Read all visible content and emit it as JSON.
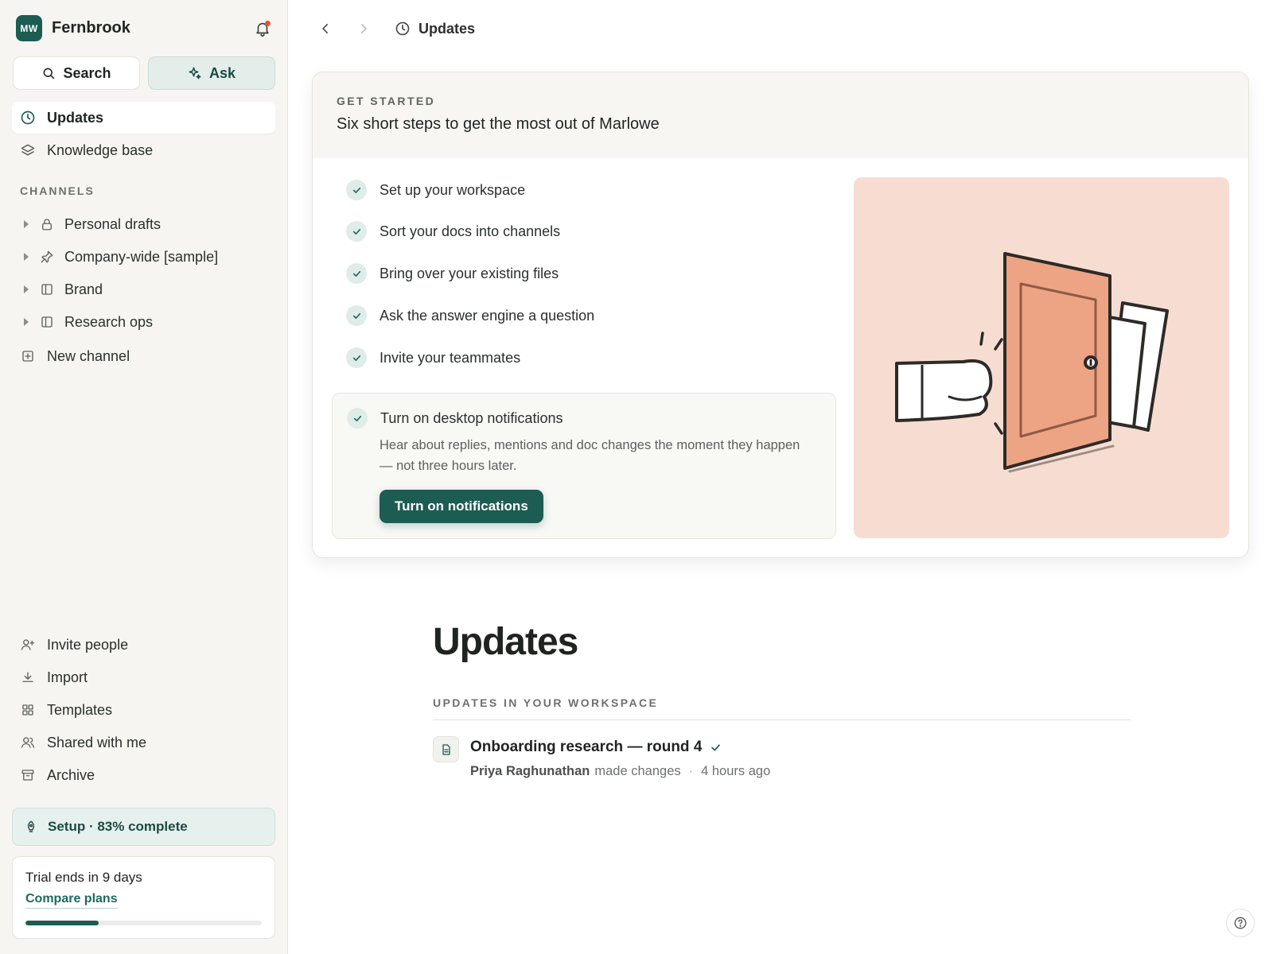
{
  "workspace": {
    "initials": "MW",
    "name": "Fernbrook"
  },
  "sidebar": {
    "search_label": "Search",
    "ask_label": "Ask",
    "nav": [
      {
        "label": "Updates",
        "icon": "clock-icon",
        "active": true
      },
      {
        "label": "Knowledge base",
        "icon": "layers-icon",
        "active": false
      }
    ],
    "channels_label": "CHANNELS",
    "channels": [
      {
        "label": "Personal drafts",
        "icon": "lock-icon"
      },
      {
        "label": "Company-wide [sample]",
        "icon": "pin-icon"
      },
      {
        "label": "Brand",
        "icon": "panel-icon"
      },
      {
        "label": "Research ops",
        "icon": "panel-icon"
      }
    ],
    "new_channel_label": "New channel",
    "bottom_nav": [
      {
        "label": "Invite people",
        "icon": "invite-user-icon"
      },
      {
        "label": "Import",
        "icon": "download-icon"
      },
      {
        "label": "Templates",
        "icon": "grid-icon"
      },
      {
        "label": "Shared with me",
        "icon": "users-icon"
      },
      {
        "label": "Archive",
        "icon": "archive-icon"
      }
    ],
    "setup_label": "Setup · 83% complete",
    "setup_progress": 0.83,
    "trial": {
      "title": "Trial ends in 9 days",
      "link": "Compare plans",
      "progress": 0.31
    }
  },
  "topbar": {
    "breadcrumb": "Updates"
  },
  "get_started": {
    "kicker": "GET STARTED",
    "title": "Six short steps to get the most out of Marlowe",
    "steps": [
      "Set up your workspace",
      "Sort your docs into channels",
      "Bring over your existing files",
      "Ask the answer engine a question",
      "Invite your teammates"
    ],
    "expanded_step": {
      "title": "Turn on desktop notifications",
      "description": "Hear about replies, mentions and doc changes the moment they happen — not three hours later.",
      "button": "Turn on notifications"
    }
  },
  "updates": {
    "heading": "Updates",
    "subheading": "UPDATES IN YOUR WORKSPACE",
    "items": [
      {
        "title": "Onboarding research — round 4",
        "author": "Priya Raghunathan",
        "action": "made changes",
        "time": "4 hours ago"
      }
    ]
  },
  "colors": {
    "accent": "#1d5c52",
    "illustration_bg": "#f7ddd1",
    "door": "#eda485",
    "notification_dot": "#e2533a"
  }
}
